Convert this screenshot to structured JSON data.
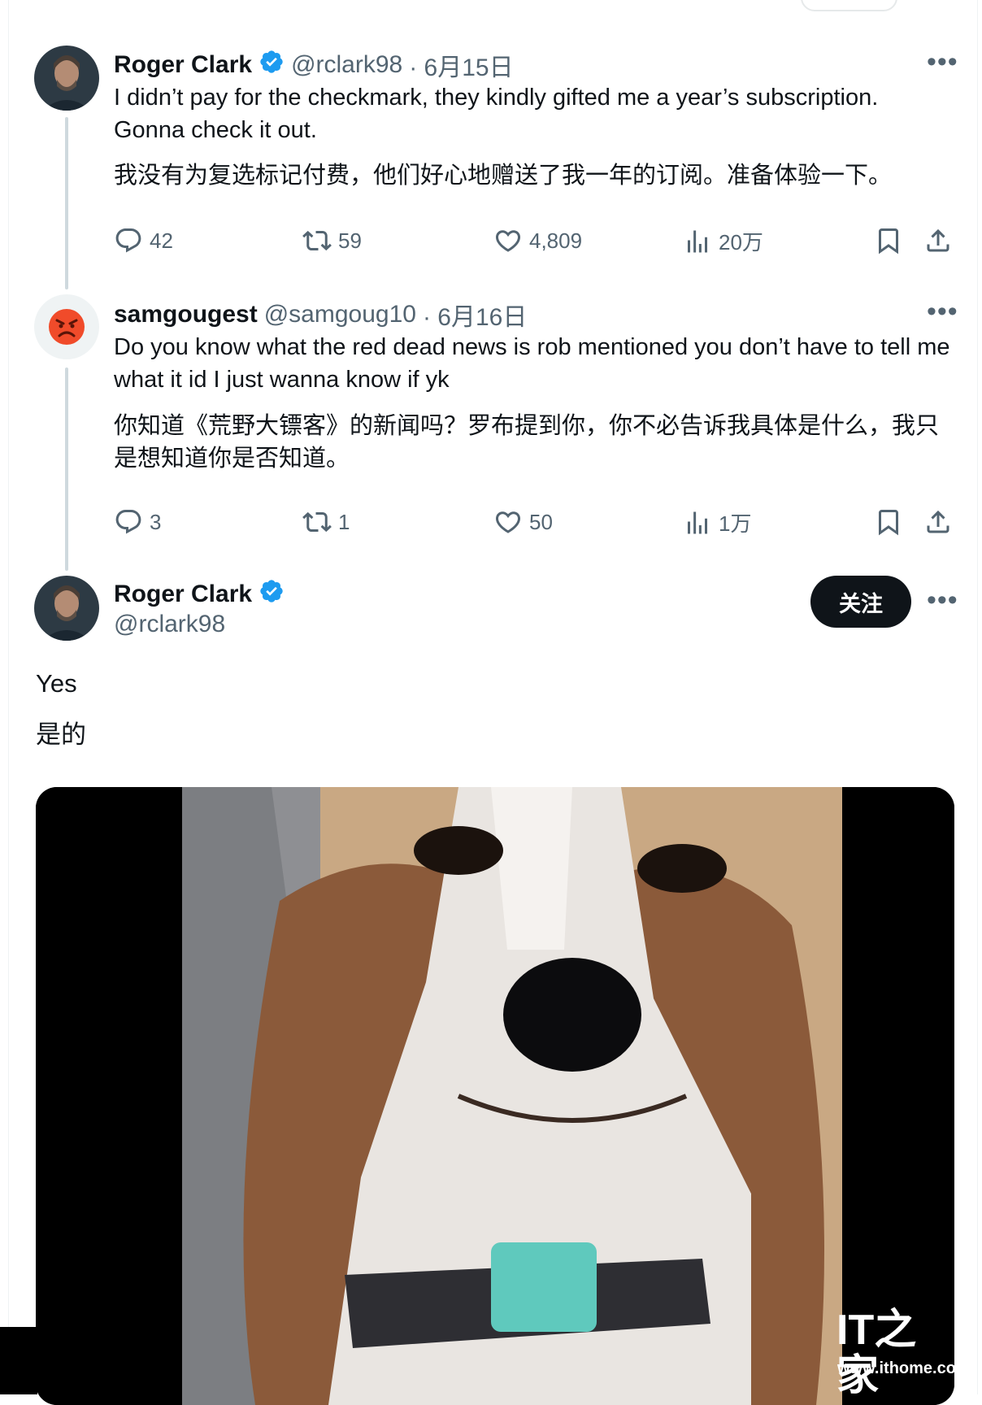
{
  "tweet1": {
    "name": "Roger Clark",
    "handle": "@rclark98",
    "date": "· 6月15日",
    "text": "I didn’t pay for the checkmark, they kindly gifted me a year’s subscription. Gonna check it out.",
    "translation": "我没有为复选标记付费，他们好心地赠送了我一年的订阅。准备体验一下。",
    "replies": "42",
    "retweets": "59",
    "likes": "4,809",
    "views": "20万"
  },
  "tweet2": {
    "name": "samgougest",
    "handle": "@samgoug10",
    "date": "· 6月16日",
    "avatar_emoji": "😡",
    "text": "Do you know what the red dead news is rob mentioned you don’t have to tell me what it id I just wanna know if yk",
    "translation": "你知道《荒野大镖客》的新闻吗？罗布提到你，你不必告诉我具体是什么，我只是想知道你是否知道。",
    "replies": "3",
    "retweets": "1",
    "likes": "50",
    "views": "1万"
  },
  "tweet3": {
    "name": "Roger Clark",
    "handle": "@rclark98",
    "follow_label": "关注",
    "text": "Yes",
    "translation": "是的"
  },
  "watermark": {
    "logo": "IT之家",
    "url": "www.ithome.co"
  },
  "colors": {
    "verified": "#1d9bf0",
    "text": "#0f1419",
    "secondary": "#536471",
    "button": "#0f1419"
  }
}
